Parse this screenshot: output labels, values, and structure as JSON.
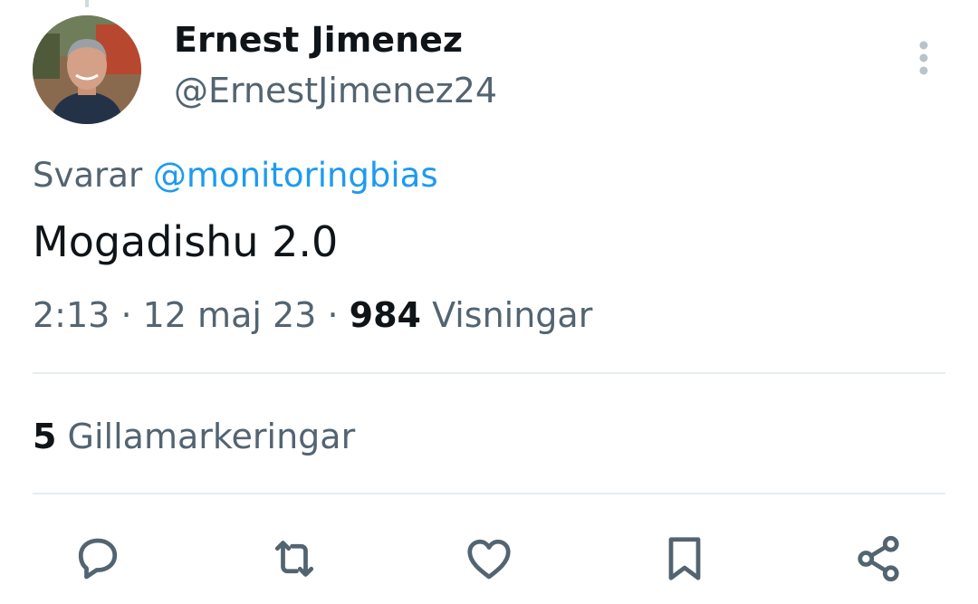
{
  "author": {
    "display_name": "Ernest Jimenez",
    "handle": "@ErnestJimenez24",
    "avatar_icon": "profile-photo"
  },
  "reply": {
    "prefix": "Svarar",
    "mention": "@monitoringbias"
  },
  "tweet": {
    "text": "Mogadishu 2.0"
  },
  "meta": {
    "time": "2:13",
    "separator": "·",
    "date": "12 maj 23",
    "views_count": "984",
    "views_label": "Visningar"
  },
  "stats": {
    "likes_count": "5",
    "likes_label": "Gillamarkeringar"
  },
  "actions": [
    {
      "name": "reply",
      "icon": "speech-bubble-icon"
    },
    {
      "name": "retweet",
      "icon": "retweet-arrows-icon"
    },
    {
      "name": "like",
      "icon": "heart-icon"
    },
    {
      "name": "bookmark",
      "icon": "bookmark-icon"
    },
    {
      "name": "share",
      "icon": "share-nodes-icon"
    }
  ],
  "colors": {
    "text_primary": "#0f1419",
    "text_secondary": "#536471",
    "accent": "#1d9bf0",
    "divider": "#e6ecf0",
    "icon": "#536471"
  }
}
